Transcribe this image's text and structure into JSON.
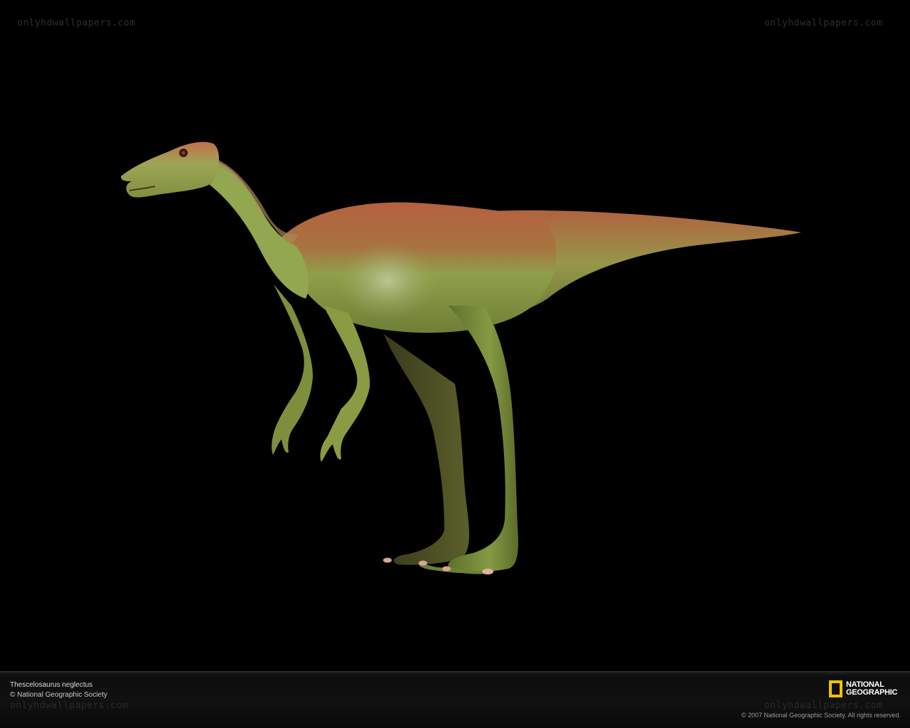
{
  "watermark": {
    "top_left": "onlyhdwallpapers.com",
    "top_right": "onlyhdwallpapers.com",
    "bottom_left": "onlyhdwallpapers.com",
    "bottom_right": "onlyhdwallpapers.com"
  },
  "caption": {
    "species": "Thescelosaurus neglectus",
    "credit": "© National Geographic Society"
  },
  "logo": {
    "line1": "NATIONAL",
    "line2": "GEOGRAPHIC",
    "frame_color": "#f2c200"
  },
  "copyright": "© 2007 National Geographic Society. All rights reserved.",
  "colors": {
    "background": "#000000",
    "skin_green": "#8fa04a",
    "skin_back": "#b5603f"
  }
}
